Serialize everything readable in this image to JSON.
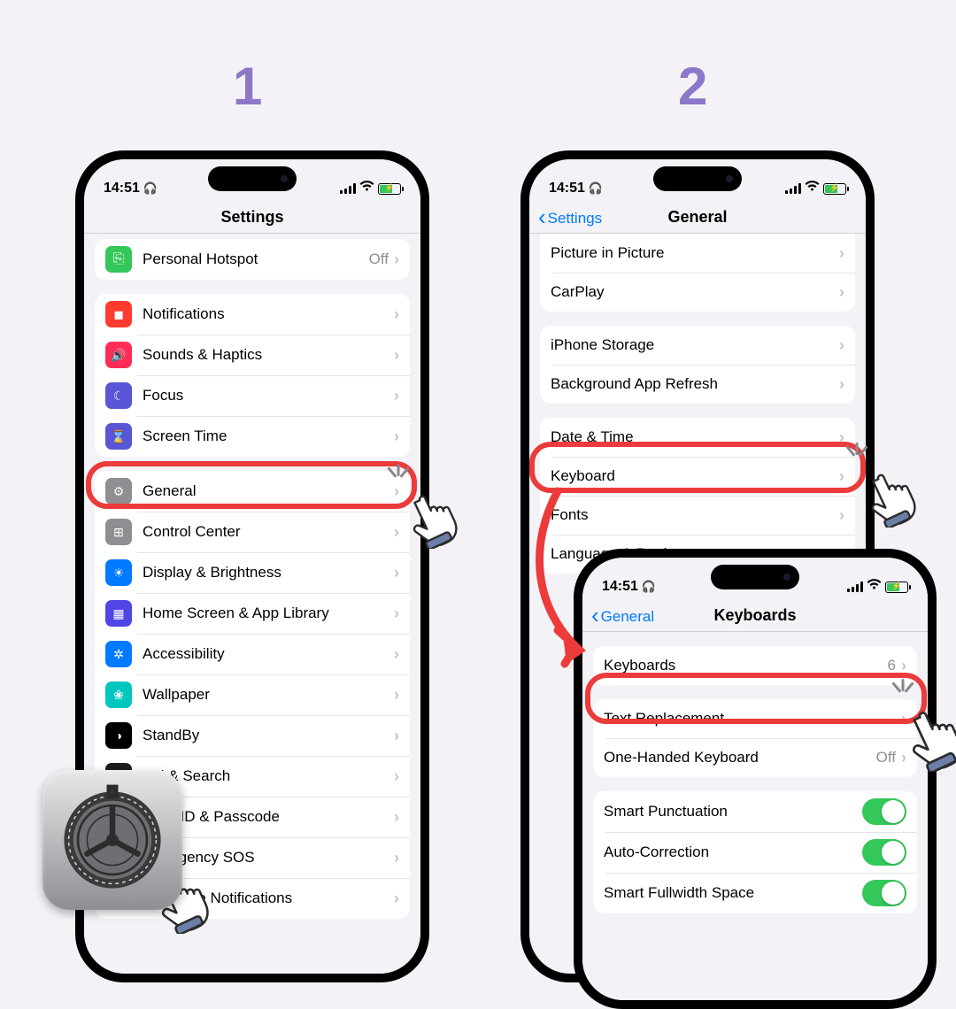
{
  "steps": {
    "one": "1",
    "two": "2"
  },
  "status": {
    "time": "14:51",
    "headphones_glyph": "🎧"
  },
  "phone1": {
    "title": "Settings",
    "hotspot": {
      "label": "Personal Hotspot",
      "value": "Off"
    },
    "rows_a": [
      {
        "label": "Notifications",
        "icon_color": "#ff3b30",
        "glyph": "◼︎"
      },
      {
        "label": "Sounds & Haptics",
        "icon_color": "#ff2d55",
        "glyph": "🔊"
      },
      {
        "label": "Focus",
        "icon_color": "#5856d6",
        "glyph": "☾"
      },
      {
        "label": "Screen Time",
        "icon_color": "#5856d6",
        "glyph": "⌛"
      }
    ],
    "rows_b": [
      {
        "label": "General",
        "icon_color": "#8e8e93",
        "glyph": "⚙"
      },
      {
        "label": "Control Center",
        "icon_color": "#8e8e93",
        "glyph": "⊞"
      },
      {
        "label": "Display & Brightness",
        "icon_color": "#007aff",
        "glyph": "☀"
      },
      {
        "label": "Home Screen & App Library",
        "icon_color": "#4f46e5",
        "glyph": "▦"
      },
      {
        "label": "Accessibility",
        "icon_color": "#007aff",
        "glyph": "✲"
      },
      {
        "label": "Wallpaper",
        "icon_color": "#00c7be",
        "glyph": "❀"
      },
      {
        "label": "StandBy",
        "icon_color": "#000000",
        "glyph": "◑"
      },
      {
        "label": "Siri & Search",
        "icon_color": "#1c1c1e",
        "glyph": "●"
      },
      {
        "label": "Face ID & Passcode",
        "icon_color": "#34c759",
        "glyph": "☻",
        "partial": "D & Passcode"
      },
      {
        "label": "Emergency SOS",
        "icon_color": "#ff3b30",
        "glyph": "SOS",
        "partial": "ncy SOS"
      },
      {
        "label": "Exposure Notifications",
        "icon_color": "#ffffff",
        "glyph": "⋯",
        "partial": "otifications"
      }
    ]
  },
  "phone2": {
    "back": "Settings",
    "title": "General",
    "rows_a": [
      {
        "label": "Picture in Picture"
      },
      {
        "label": "CarPlay"
      }
    ],
    "rows_b": [
      {
        "label": "iPhone Storage"
      },
      {
        "label": "Background App Refresh"
      }
    ],
    "rows_c": [
      {
        "label": "Date & Time"
      },
      {
        "label": "Keyboard"
      },
      {
        "label": "Fonts"
      },
      {
        "label": "Language & Region"
      }
    ]
  },
  "phone3": {
    "back": "General",
    "title": "Keyboards",
    "rows_a": [
      {
        "label": "Keyboards",
        "value": "6"
      }
    ],
    "rows_b": [
      {
        "label": "Text Replacement"
      },
      {
        "label": "One-Handed Keyboard",
        "value": "Off"
      }
    ],
    "rows_c": [
      {
        "label": "Smart Punctuation",
        "toggle": true
      },
      {
        "label": "Auto-Correction",
        "toggle": true
      },
      {
        "label": "Smart Fullwidth Space",
        "toggle": true
      }
    ]
  }
}
